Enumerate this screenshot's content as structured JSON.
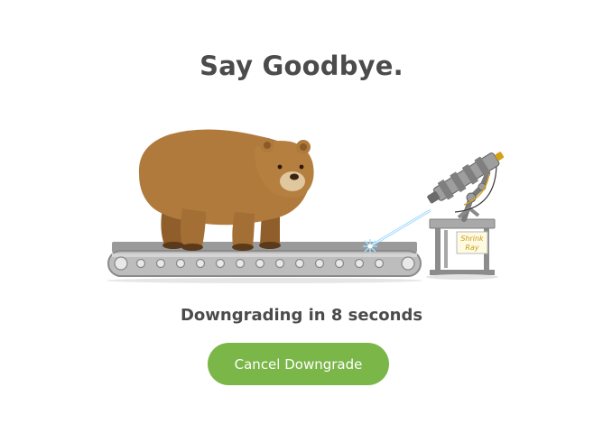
{
  "dialog": {
    "title": "Say Goodbye.",
    "status_text": "Downgrading in 8 seconds",
    "cancel_button_label": "Cancel Downgrade"
  },
  "illustration": {
    "sign_text_line1": "Shrink",
    "sign_text_line2": "Ray"
  },
  "colors": {
    "button_green": "#7ab648",
    "title_text": "#4b4b4b",
    "bear_brown": "#b07a3c",
    "laser_blue": "#7fd0ff"
  }
}
